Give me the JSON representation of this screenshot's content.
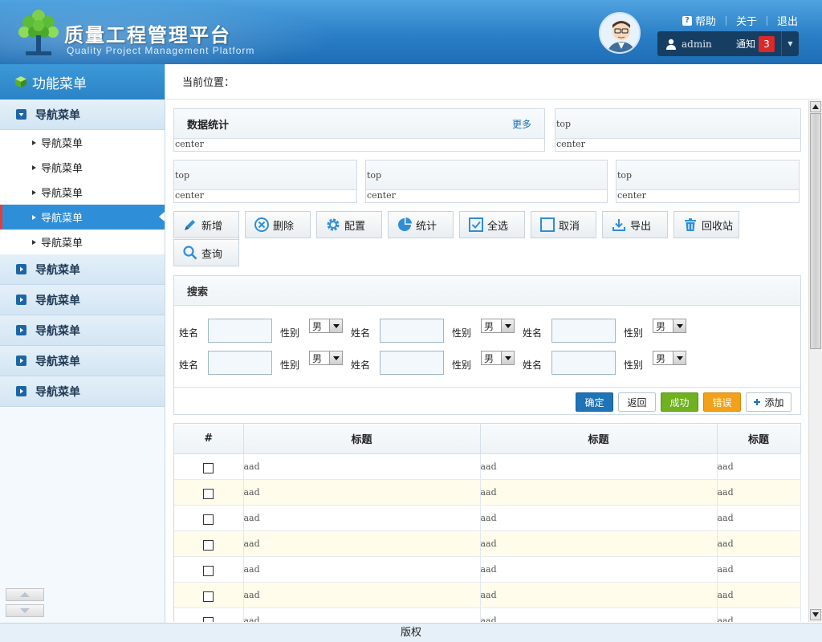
{
  "header": {
    "title": "质量工程管理平台",
    "subtitle": "Quality Project Management Platform",
    "links": {
      "help": "帮助",
      "about": "关于",
      "logout": "退出"
    },
    "user": {
      "name": "admin",
      "notice_label": "通知",
      "notice_count": "3"
    }
  },
  "sidebar": {
    "title": "功能菜单",
    "groups": [
      {
        "label": "导航菜单",
        "expanded": true,
        "items": [
          "导航菜单",
          "导航菜单",
          "导航菜单",
          "导航菜单",
          "导航菜单"
        ],
        "active_index": 3
      },
      {
        "label": "导航菜单"
      },
      {
        "label": "导航菜单"
      },
      {
        "label": "导航菜单"
      },
      {
        "label": "导航菜单"
      },
      {
        "label": "导航菜单"
      }
    ]
  },
  "breadcrumb": {
    "label": "当前位置："
  },
  "panels": {
    "stats": {
      "title": "数据统计",
      "more": "更多",
      "body": "center"
    },
    "p2": {
      "head": "top",
      "body": "center"
    },
    "p3": {
      "head": "top",
      "body": "center"
    },
    "p4": {
      "head": "top",
      "body": "center"
    },
    "p5": {
      "head": "top",
      "body": "center"
    }
  },
  "toolbar": {
    "add": "新增",
    "delete": "删除",
    "config": "配置",
    "stats": "统计",
    "select_all": "全选",
    "cancel": "取消",
    "export": "导出",
    "recycle": "回收站",
    "query": "查询"
  },
  "search": {
    "title": "搜索",
    "name_label": "姓名",
    "gender_label": "性别",
    "gender_value": "男",
    "buttons": {
      "confirm": "确定",
      "back": "返回",
      "success": "成功",
      "error": "错误",
      "add": "添加"
    }
  },
  "grid": {
    "columns": [
      "#",
      "标题",
      "标题",
      "标题"
    ],
    "rows": [
      [
        "aad",
        "aad",
        "aad"
      ],
      [
        "aad",
        "aad",
        "aad"
      ],
      [
        "aad",
        "aad",
        "aad"
      ],
      [
        "aad",
        "aad",
        "aad"
      ],
      [
        "aad",
        "aad",
        "aad"
      ],
      [
        "aad",
        "aad",
        "aad"
      ],
      [
        "aad",
        "aad",
        "aad"
      ]
    ]
  },
  "footer": {
    "copyright": "版权"
  },
  "colors": {
    "header_blue": "#2a7fc6",
    "active_item": "#2e8ed7",
    "confirm": "#1f73b7",
    "success": "#6fb11e",
    "error": "#f2a118",
    "badge": "#d9292a"
  }
}
